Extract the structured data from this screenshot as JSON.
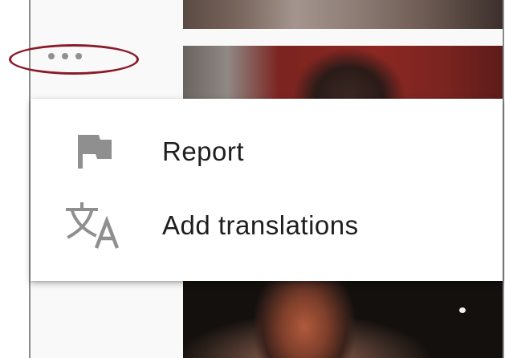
{
  "more_button": {
    "icon": "more-horiz-icon",
    "dot_color": "#909090"
  },
  "highlight": {
    "color": "#8b1a2b"
  },
  "menu": {
    "items": [
      {
        "label": "Report",
        "icon": "flag-icon"
      },
      {
        "label": "Add translations",
        "icon": "translate-icon"
      }
    ]
  }
}
